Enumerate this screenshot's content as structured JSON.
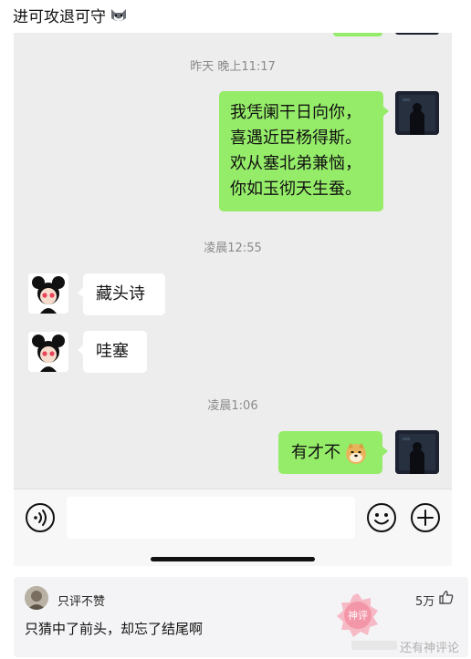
{
  "post": {
    "title": "进可攻退可守"
  },
  "chat": {
    "timestamps": {
      "first": "昨天 晚上11:17",
      "second": "凌晨12:55",
      "third": "凌晨1:06"
    },
    "messages": {
      "poem_lines": [
        "我凭阑干日向你，",
        "喜遇近臣杨得斯。",
        "欢从塞北弟兼恼，",
        "你如玉彻天生蚕。"
      ],
      "reply_one": "藏头诗",
      "reply_two": "哇塞",
      "last_sent": "有才不"
    },
    "colors": {
      "sent_bubble": "#95ec69",
      "received_bubble": "#ffffff",
      "chat_background": "#ededed"
    }
  },
  "comment": {
    "username": "只评不赞",
    "text": "只猜中了前头，却忘了结尾啊",
    "likes": "5万"
  },
  "branding": {
    "stamp_text": "神评",
    "watermark": "还有神评论"
  }
}
